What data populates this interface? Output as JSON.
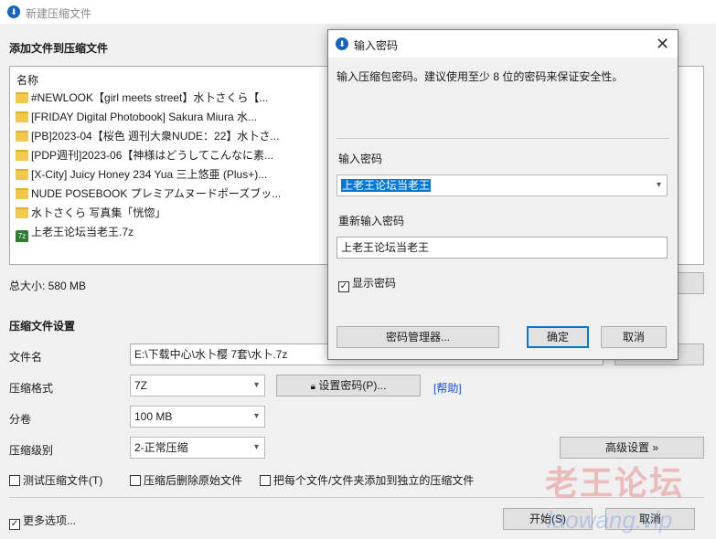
{
  "window": {
    "title": "新建压缩文件"
  },
  "files_section": {
    "title": "添加文件到压缩文件",
    "column_name": "名称",
    "items": [
      {
        "type": "folder",
        "name": "#NEWLOOK【girl meets street】水卜さくら【..."
      },
      {
        "type": "folder",
        "name": "[FRIDAY Digital Photobook] Sakura Miura 水..."
      },
      {
        "type": "folder",
        "name": "[PB]2023-04【桜色 週刊大衆NUDE：22】水卜さ..."
      },
      {
        "type": "folder",
        "name": "[PDP週刊]2023-06【神様はどうしてこんなに素..."
      },
      {
        "type": "folder",
        "name": "[X-City] Juicy Honey 234 Yua 三上悠亜 (Plus+)..."
      },
      {
        "type": "folder",
        "name": "NUDE POSEBOOK プレミアムヌードポーズブッ..."
      },
      {
        "type": "folder",
        "name": "水卜さくら 写真集「恍惚」"
      },
      {
        "type": "archive",
        "name": "上老王论坛当老王.7z"
      }
    ],
    "total_size": "总大小: 580 MB"
  },
  "settings": {
    "title": "压缩文件设置",
    "filename_label": "文件名",
    "filename_value": "E:\\下载中心\\水卜樱 7套\\水卜.7z",
    "format_label": "压缩格式",
    "format_value": "7Z",
    "set_password_button": "设置密码(P)...",
    "help_link": "[帮助]",
    "split_label": "分卷",
    "split_value": "100 MB",
    "level_label": "压缩级别",
    "level_value": "2-正常压缩",
    "advanced_button": "高级设置 »",
    "test_checkbox": "测试压缩文件(T)",
    "delete_checkbox": "压缩后删除原始文件",
    "separate_checkbox": "把每个文件/文件夹添加到独立的压缩文件",
    "more_options": "更多选项...",
    "start_button": "开始(S)",
    "cancel_button": "取消"
  },
  "dialog": {
    "title": "输入密码",
    "hint": "输入压缩包密码。建议使用至少 8 位的密码来保证安全性。",
    "password_label": "输入密码",
    "password_value": "上老王论坛当老王",
    "confirm_label": "重新输入密码",
    "confirm_value": "上老王论坛当老王",
    "show_password": "显示密码",
    "show_password_checked": true,
    "manager_button": "密码管理器...",
    "ok_button": "确定",
    "cancel_button": "取消"
  },
  "watermark": {
    "cn": "老王论坛",
    "en": "laowang.vip"
  }
}
